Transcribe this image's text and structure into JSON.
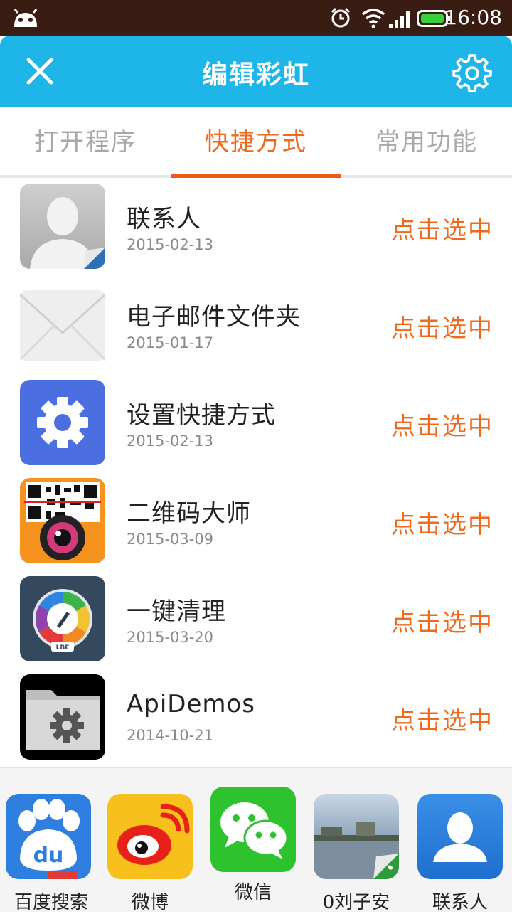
{
  "status_bar": {
    "time": "16:08"
  },
  "header": {
    "title": "编辑彩虹"
  },
  "tabs": [
    {
      "label": "打开程序",
      "active": false
    },
    {
      "label": "快捷方式",
      "active": true
    },
    {
      "label": "常用功能",
      "active": false
    }
  ],
  "list": {
    "items": [
      {
        "title": "联系人",
        "date": "2015-02-13",
        "action": "点击选中",
        "icon": "contact-icon"
      },
      {
        "title": "电子邮件文件夹",
        "date": "2015-01-17",
        "action": "点击选中",
        "icon": "mail-envelope-icon"
      },
      {
        "title": "设置快捷方式",
        "date": "2015-02-13",
        "action": "点击选中",
        "icon": "settings-gear-icon"
      },
      {
        "title": "二维码大师",
        "date": "2015-03-09",
        "action": "点击选中",
        "icon": "qr-camera-icon"
      },
      {
        "title": "一键清理",
        "date": "2015-03-20",
        "action": "点击选中",
        "icon": "cleaner-dial-icon"
      },
      {
        "title": "ApiDemos",
        "date": "2014-10-21",
        "action": "点击选中",
        "icon": "folder-gear-icon"
      }
    ]
  },
  "dock": {
    "items": [
      {
        "label": "百度搜索",
        "icon": "baidu-paw-icon"
      },
      {
        "label": "微博",
        "icon": "weibo-icon"
      },
      {
        "label": "微信",
        "icon": "wechat-icon"
      },
      {
        "label": "0刘子安",
        "icon": "contact-photo-icon"
      },
      {
        "label": "联系人",
        "icon": "contacts-icon"
      }
    ]
  },
  "colors": {
    "header": "#1eb6e8",
    "accent": "#f06a1e",
    "statusbar": "#3a1d12"
  }
}
